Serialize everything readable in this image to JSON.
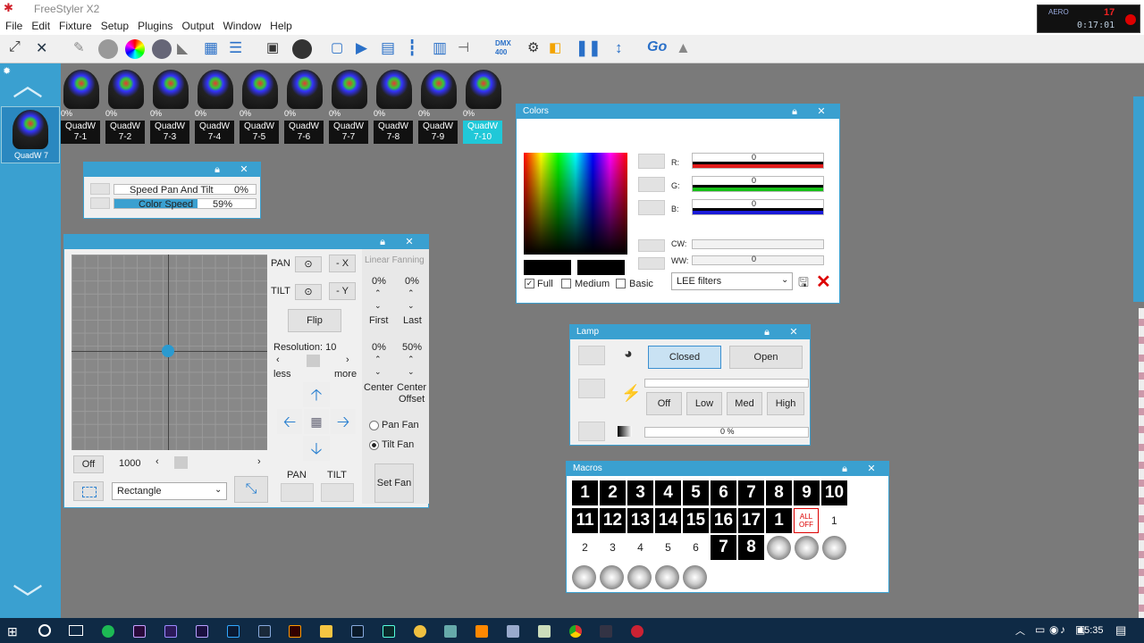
{
  "app": {
    "title": "FreeStyler X2"
  },
  "menu": [
    "File",
    "Edit",
    "Fixture",
    "Setup",
    "Plugins",
    "Output",
    "Window",
    "Help"
  ],
  "toolbar": {
    "go_label": "Go",
    "dmx_label": "DMX 400"
  },
  "timer": {
    "line1": "AERO",
    "line2": "0:17:01",
    "counter": "17"
  },
  "left_panel": {
    "selected_fixture": "QuadW 7"
  },
  "fixtures": [
    {
      "pct": "0%",
      "line1": "QuadW",
      "line2": "7-1"
    },
    {
      "pct": "0%",
      "line1": "QuadW",
      "line2": "7-2"
    },
    {
      "pct": "0%",
      "line1": "QuadW",
      "line2": "7-3"
    },
    {
      "pct": "0%",
      "line1": "QuadW",
      "line2": "7-4"
    },
    {
      "pct": "0%",
      "line1": "QuadW",
      "line2": "7-5"
    },
    {
      "pct": "0%",
      "line1": "QuadW",
      "line2": "7-6"
    },
    {
      "pct": "0%",
      "line1": "QuadW",
      "line2": "7-7"
    },
    {
      "pct": "0%",
      "line1": "QuadW",
      "line2": "7-8"
    },
    {
      "pct": "0%",
      "line1": "QuadW",
      "line2": "7-9"
    },
    {
      "pct": "0%",
      "line1": "QuadW",
      "line2": "7-10"
    }
  ],
  "speed": {
    "pan_tilt_label": "Speed Pan And Tilt",
    "pan_tilt_value": "0%",
    "pan_tilt_fill": 0.0,
    "color_label": "Color Speed",
    "color_value": "59%",
    "color_fill": 0.59
  },
  "pantilt": {
    "pan": "PAN",
    "tilt": "TILT",
    "minus_x": "- X",
    "minus_y": "- Y",
    "flip": "Flip",
    "resolution": "Resolution: 10",
    "less": "less",
    "more": "more",
    "off": "Off",
    "value": "1000",
    "shape": "Rectangle",
    "pan_label": "PAN",
    "tilt_label": "TILT",
    "fanning_title": "Linear Fanning",
    "first_pct": "0%",
    "last_pct": "0%",
    "first": "First",
    "last": "Last",
    "center_pct": "0%",
    "offset_pct": "50%",
    "center": "Center",
    "center_offset_1": "Center",
    "center_offset_2": "Offset",
    "pan_fan": "Pan Fan",
    "tilt_fan": "Tilt Fan",
    "set_fan": "Set Fan"
  },
  "colors": {
    "title": "Colors",
    "r_label": "R:",
    "g_label": "G:",
    "b_label": "B:",
    "cw_label": "CW:",
    "ww_label": "WW:",
    "r_value": "0",
    "g_value": "0",
    "b_value": "0",
    "ww_value": "0",
    "full": "Full",
    "medium": "Medium",
    "basic": "Basic",
    "filter": "LEE filters",
    "color_red": "#e31b1b",
    "color_green": "#18c018",
    "color_blue": "#1b1bd8"
  },
  "lamp": {
    "title": "Lamp",
    "closed": "Closed",
    "open": "Open",
    "off": "Off",
    "low": "Low",
    "med": "Med",
    "high": "High",
    "dimmer": "0 %"
  },
  "macros": {
    "title": "Macros",
    "row1": [
      "1",
      "2",
      "3",
      "4",
      "5",
      "6",
      "7",
      "8",
      "9",
      "10"
    ],
    "row2": [
      "11",
      "12",
      "13",
      "14",
      "15",
      "16",
      "17",
      "1"
    ],
    "all_off": "ALL OFF",
    "row2_tail": "1",
    "row3": [
      "2",
      "3",
      "4",
      "5",
      "6",
      "7",
      "8"
    ]
  },
  "taskbar": {
    "time": "15:35"
  }
}
